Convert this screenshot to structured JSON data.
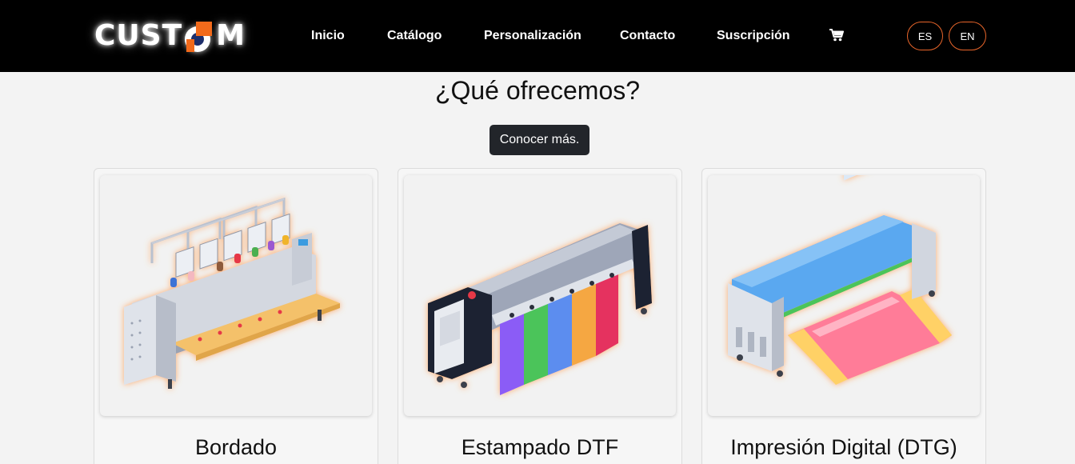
{
  "brand": {
    "logo_text_left": "CUST",
    "logo_text_right": "M",
    "accent": "#f26a1b",
    "logo_dark": "#1d2e6b"
  },
  "nav": {
    "links": [
      "Inicio",
      "Catálogo",
      "Personalización",
      "Contacto",
      "Suscripción"
    ],
    "cart_icon": "shopping-cart-icon",
    "languages": [
      "ES",
      "EN"
    ],
    "lang_border_color": "#e8652a"
  },
  "hero": {
    "title": "¿Qué ofrecemos?",
    "button_label": "Conocer más."
  },
  "services": [
    {
      "title": "Bordado",
      "illustration": "embroidery-machine"
    },
    {
      "title": "Estampado DTF",
      "illustration": "dtf-printer"
    },
    {
      "title": "Impresión Digital (DTG)",
      "illustration": "dtg-printer"
    }
  ]
}
